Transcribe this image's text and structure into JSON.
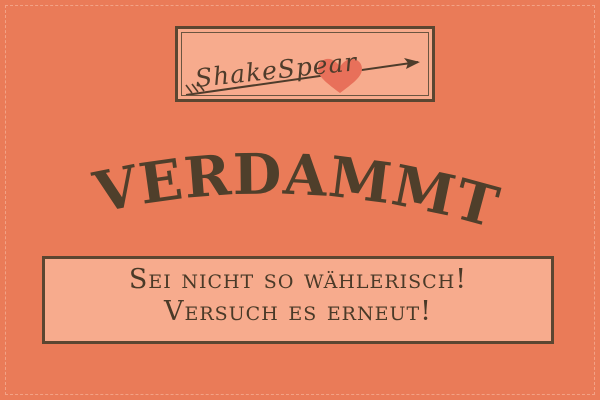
{
  "logo": {
    "text": "ShakeSpear",
    "icon": "heart-arrow-icon",
    "heart_color": "#e8705a",
    "ink_color": "#4e3c2b"
  },
  "headline": "VERDAMMT.",
  "message": {
    "line1": "Sei nicht so wählerisch!",
    "line2": "Versuch es erneut!"
  },
  "colors": {
    "background": "#ea7b58",
    "panel": "#f7ab8d",
    "border": "#5b4631",
    "text": "#4f3f2b"
  }
}
